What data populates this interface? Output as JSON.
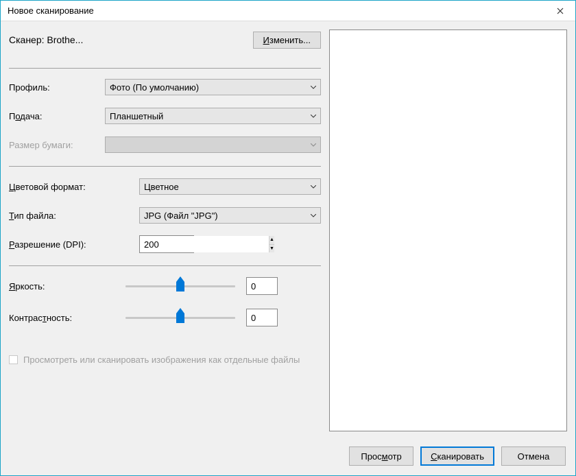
{
  "window": {
    "title": "Новое сканирование"
  },
  "scanner": {
    "label_prefix": "Сканер: ",
    "name": "Brothe...",
    "change_btn": "Изменить..."
  },
  "fields": {
    "profile": {
      "label": "Профиль:",
      "value": "Фото (По умолчанию)"
    },
    "source": {
      "label": "Подача:",
      "value": "Планшетный"
    },
    "paper_size": {
      "label": "Размер бумаги:",
      "value": ""
    },
    "color_format": {
      "label": "Цветовой формат:",
      "value": "Цветное"
    },
    "file_type": {
      "label": "Тип файла:",
      "value": "JPG (Файл \"JPG\")"
    },
    "resolution": {
      "label": "Разрешение (DPI):",
      "value": "200"
    },
    "brightness": {
      "label": "Яркость:",
      "value": "0"
    },
    "contrast": {
      "label": "Контрастность:",
      "value": "0"
    }
  },
  "checkbox": {
    "label": "Просмотреть или сканировать изображения как отдельные файлы"
  },
  "footer": {
    "preview": "Просмотр",
    "scan": "Сканировать",
    "cancel": "Отмена"
  }
}
